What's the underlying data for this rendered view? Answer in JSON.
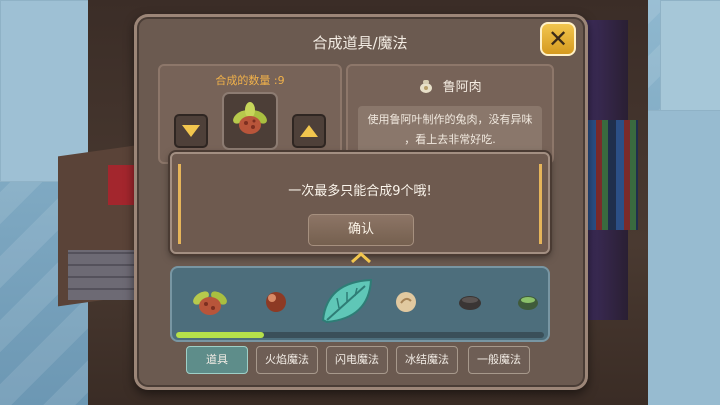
{
  "window": {
    "title": "合成道具/魔法",
    "close_icon": "close-icon"
  },
  "crafter": {
    "quantity_label": "合成的数量 :9",
    "quantity": 9,
    "selected_item_icon": "herb-meat-icon"
  },
  "item_info": {
    "name": "鲁阿肉",
    "icon": "sack-icon",
    "description_line1": "使用鲁阿叶制作的兔肉，没有异味",
    "description_line2": "，看上去非常好吃."
  },
  "dialog": {
    "message": "一次最多只能合成9个哦!",
    "confirm_label": "确认"
  },
  "inventory": {
    "items": [
      {
        "icon": "herb-meat-icon"
      },
      {
        "icon": "red-nut-icon"
      },
      {
        "icon": "green-leaf-icon"
      },
      {
        "icon": "round-seed-icon"
      },
      {
        "icon": "dark-stone-icon"
      },
      {
        "icon": "green-jar-icon"
      }
    ],
    "scroll_progress": 0.24
  },
  "tabs": [
    {
      "label": "道具",
      "active": true
    },
    {
      "label": "火焰魔法",
      "active": false
    },
    {
      "label": "闪电魔法",
      "active": false
    },
    {
      "label": "冰结魔法",
      "active": false
    },
    {
      "label": "一般魔法",
      "active": false
    }
  ],
  "colors": {
    "accent_gold": "#f2c64e",
    "quantity_text": "#f0b14a",
    "progress_fill": "#b6e04a",
    "active_tab": "#5e8d8a"
  }
}
